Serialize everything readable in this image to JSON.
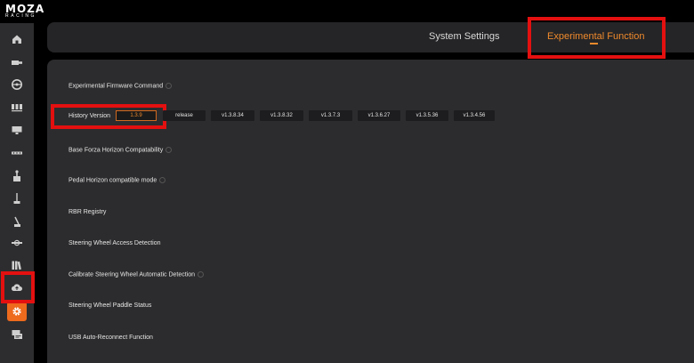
{
  "app": {
    "logo_main": "MOZA",
    "logo_sub": "RACING"
  },
  "tabs": {
    "system_settings": "System Settings",
    "experimental_function": "Experimental Function"
  },
  "sidebar": {
    "icons": [
      "home-icon",
      "wheelbase-icon",
      "steering-wheel-icon",
      "pedals-icon",
      "dashboard-icon",
      "handbrake-icon",
      "shifter-icon",
      "sequential-shifter-icon",
      "stalk-icon",
      "hub-icon",
      "library-icon",
      "cloud-icon",
      "settings-icon",
      "feedback-icon"
    ],
    "active": "settings-icon"
  },
  "content": {
    "experimental_firmware_command": "Experimental Firmware Command",
    "history_version_label": "History Version",
    "current_version": "1.3.9",
    "version_buttons": [
      "release",
      "v1.3.8.34",
      "v1.3.8.32",
      "v1.3.7.3",
      "v1.3.6.27",
      "v1.3.5.36",
      "v1.3.4.56"
    ],
    "base_forza": "Base Forza Horizon Compatability",
    "pedal_horizon": "Pedal Horizon compatible mode",
    "rbr_registry": "RBR Registry",
    "steering_wheel_access": "Steering Wheel Access Detection",
    "calibrate_steering": "Calibrate Steering Wheel Automatic Detection",
    "paddle_status": "Steering Wheel Paddle Status",
    "usb_reconnect": "USB Auto-Reconnect Function"
  },
  "colors": {
    "accent": "#ee6a1d",
    "highlight": "#e41010",
    "panel": "#2c2c2e",
    "sidebar": "#2d2d2f"
  }
}
